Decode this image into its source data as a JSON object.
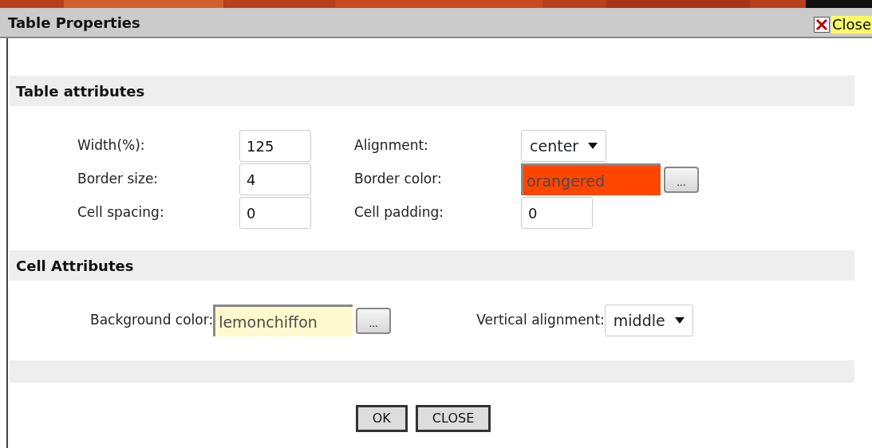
{
  "window": {
    "title": "Table Properties",
    "close_label": "Close"
  },
  "sections": [
    {
      "title": "Table attributes",
      "kind": "grid",
      "fields": [
        {
          "label": "Width(%):",
          "kind": "text",
          "value": "125"
        },
        {
          "label": "Alignment:",
          "kind": "select",
          "value": "center"
        },
        {
          "label": "Border size:",
          "kind": "text",
          "value": "4"
        },
        {
          "label": "Border color:",
          "kind": "color",
          "value": "orangered",
          "color": "#ff4500"
        },
        {
          "label": "Cell spacing:",
          "kind": "text",
          "value": "0"
        },
        {
          "label": "Cell padding:",
          "kind": "text",
          "value": "0"
        }
      ]
    },
    {
      "title": "Cell Attributes",
      "kind": "inline",
      "fields": [
        {
          "label": "Background color:",
          "kind": "color",
          "value": "lemonchiffon",
          "color": "#fffacd"
        },
        {
          "label": "Vertical alignment:",
          "kind": "select",
          "value": "middle"
        }
      ]
    }
  ],
  "picker_label": "...",
  "buttons": [
    "OK",
    "CLOSE"
  ]
}
